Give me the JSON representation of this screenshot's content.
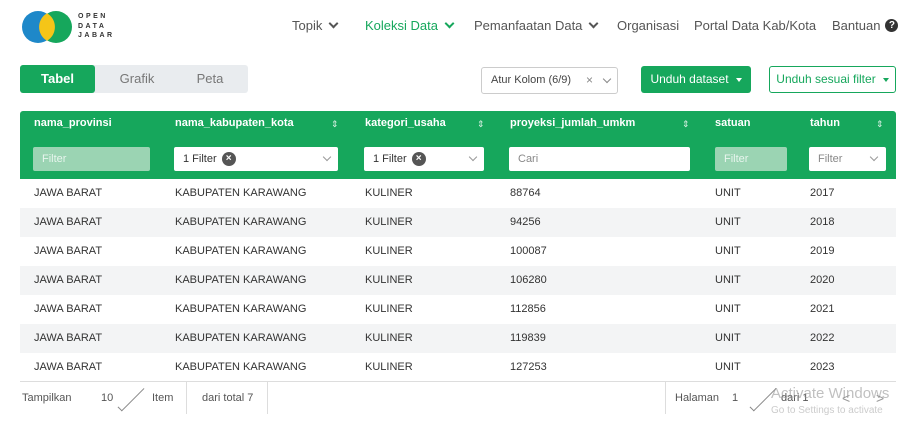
{
  "logo": {
    "line1": "OPEN",
    "line2": "DATA",
    "line3": "JABAR"
  },
  "nav": {
    "items": [
      {
        "label": "Topik"
      },
      {
        "label": "Koleksi Data"
      },
      {
        "label": "Pemanfaatan Data"
      },
      {
        "label": "Organisasi"
      },
      {
        "label": "Portal Data Kab/Kota"
      },
      {
        "label": "Bantuan"
      }
    ],
    "help_icon": "?"
  },
  "colors": {
    "brand": "#16a75c",
    "filter_empty": "#9bd4b3"
  },
  "view_tabs": [
    "Tabel",
    "Grafik",
    "Peta"
  ],
  "toolbar": {
    "columns_select": "Atur Kolom (6/9)",
    "clear": "×",
    "download_label": "Unduh dataset",
    "download_filter_label": "Unduh sesuai filter"
  },
  "table": {
    "columns": [
      "nama_provinsi",
      "nama_kabupaten_kota",
      "kategori_usaha",
      "proyeksi_jumlah_umkm",
      "satuan",
      "tahun"
    ],
    "sort_icon": "⇕",
    "filters": {
      "nama_provinsi": "Filter",
      "nama_kabupaten_kota": "1 Filter",
      "kategori_usaha": "1 Filter",
      "proyeksi_jumlah_umkm": "Cari",
      "satuan": "Filter",
      "tahun": "Filter",
      "clear_icon": "×"
    },
    "rows": [
      [
        "JAWA BARAT",
        "KABUPATEN KARAWANG",
        "KULINER",
        "88764",
        "UNIT",
        "2017"
      ],
      [
        "JAWA BARAT",
        "KABUPATEN KARAWANG",
        "KULINER",
        "94256",
        "UNIT",
        "2018"
      ],
      [
        "JAWA BARAT",
        "KABUPATEN KARAWANG",
        "KULINER",
        "100087",
        "UNIT",
        "2019"
      ],
      [
        "JAWA BARAT",
        "KABUPATEN KARAWANG",
        "KULINER",
        "106280",
        "UNIT",
        "2020"
      ],
      [
        "JAWA BARAT",
        "KABUPATEN KARAWANG",
        "KULINER",
        "112856",
        "UNIT",
        "2021"
      ],
      [
        "JAWA BARAT",
        "KABUPATEN KARAWANG",
        "KULINER",
        "119839",
        "UNIT",
        "2022"
      ],
      [
        "JAWA BARAT",
        "KABUPATEN KARAWANG",
        "KULINER",
        "127253",
        "UNIT",
        "2023"
      ]
    ]
  },
  "footer": {
    "show_label": "Tampilkan",
    "page_size": "10",
    "item_label": "Item",
    "total_label": "dari total 7",
    "page_label": "Halaman",
    "page": "1",
    "of_label": "dari 1",
    "prev": "<",
    "next": ">"
  },
  "watermark": {
    "line1": "Activate Windows",
    "line2": "Go to Settings to activate"
  }
}
